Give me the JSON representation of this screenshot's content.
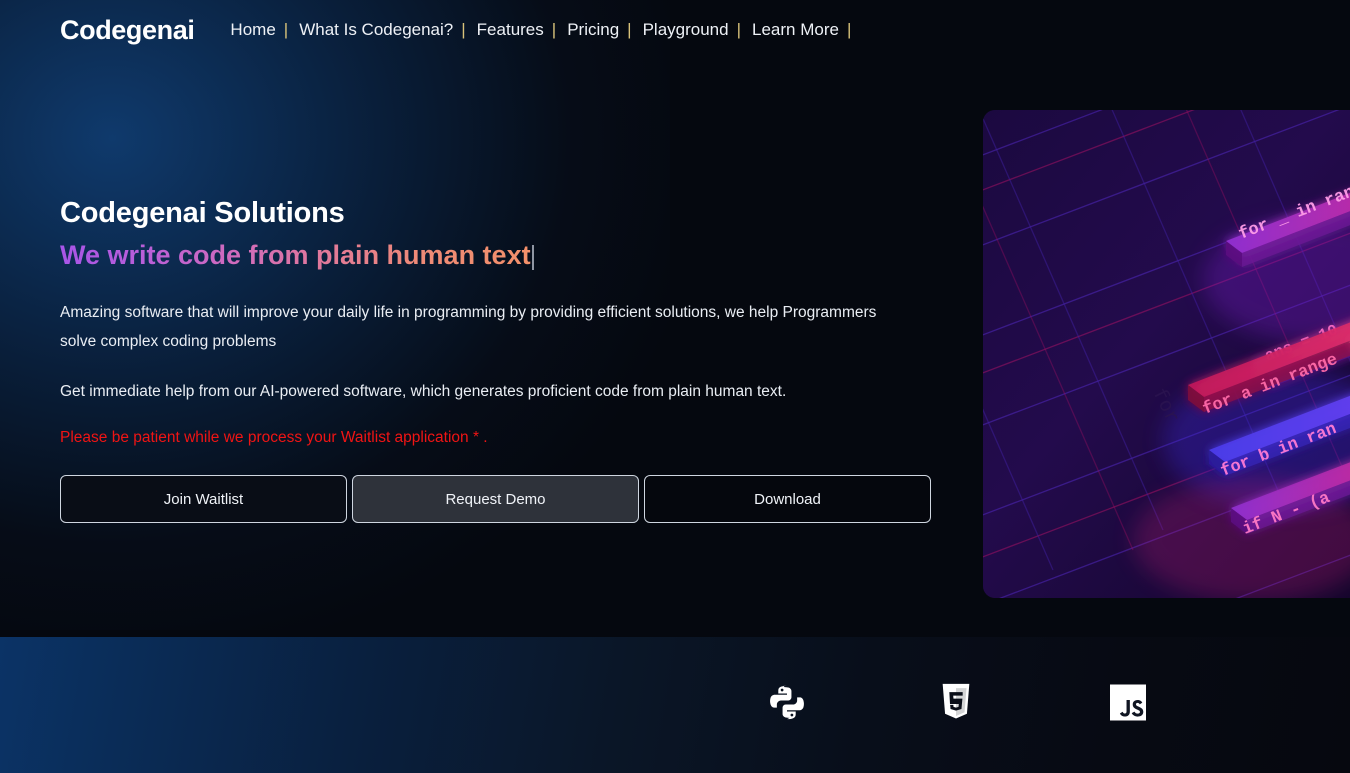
{
  "site": {
    "logo": "Codegenai",
    "brand_color": "#ffffff",
    "accent_separator_color": "#d8c27a",
    "warning_color": "#f01414",
    "gradient_start": "#a855e8",
    "gradient_end": "#f3906a"
  },
  "nav": {
    "separator": "|",
    "items": [
      {
        "label": "Home"
      },
      {
        "label": "What Is Codegenai?"
      },
      {
        "label": "Features"
      },
      {
        "label": "Pricing"
      },
      {
        "label": "Playground"
      },
      {
        "label": "Learn More"
      }
    ]
  },
  "hero": {
    "title": "Codegenai Solutions",
    "subtitle": "We write code from plain human text",
    "paragraph_1": "Amazing software that will improve your daily life in programming by providing efficient solutions, we help Programmers solve complex coding problems",
    "paragraph_2": "Get immediate help from our AI-powered software, which generates proficient code from plain human text.",
    "warning": "Please be patient while we process your Waitlist application * .",
    "buttons": [
      {
        "label": "Join Waitlist",
        "state": "default"
      },
      {
        "label": "Request Demo",
        "state": "hover"
      },
      {
        "label": "Download",
        "state": "default"
      }
    ]
  },
  "hero_image": {
    "alt": "neon isometric code blocks",
    "code_bars": [
      "for _ in ran",
      "ans = 10",
      "for a in range",
      "for b in ran",
      "if N - (a"
    ]
  },
  "tech_bar": {
    "icons": [
      {
        "name": "python-icon",
        "label": "Python"
      },
      {
        "name": "html5-icon",
        "label": "HTML5"
      },
      {
        "name": "javascript-icon",
        "label": "JS"
      }
    ]
  }
}
